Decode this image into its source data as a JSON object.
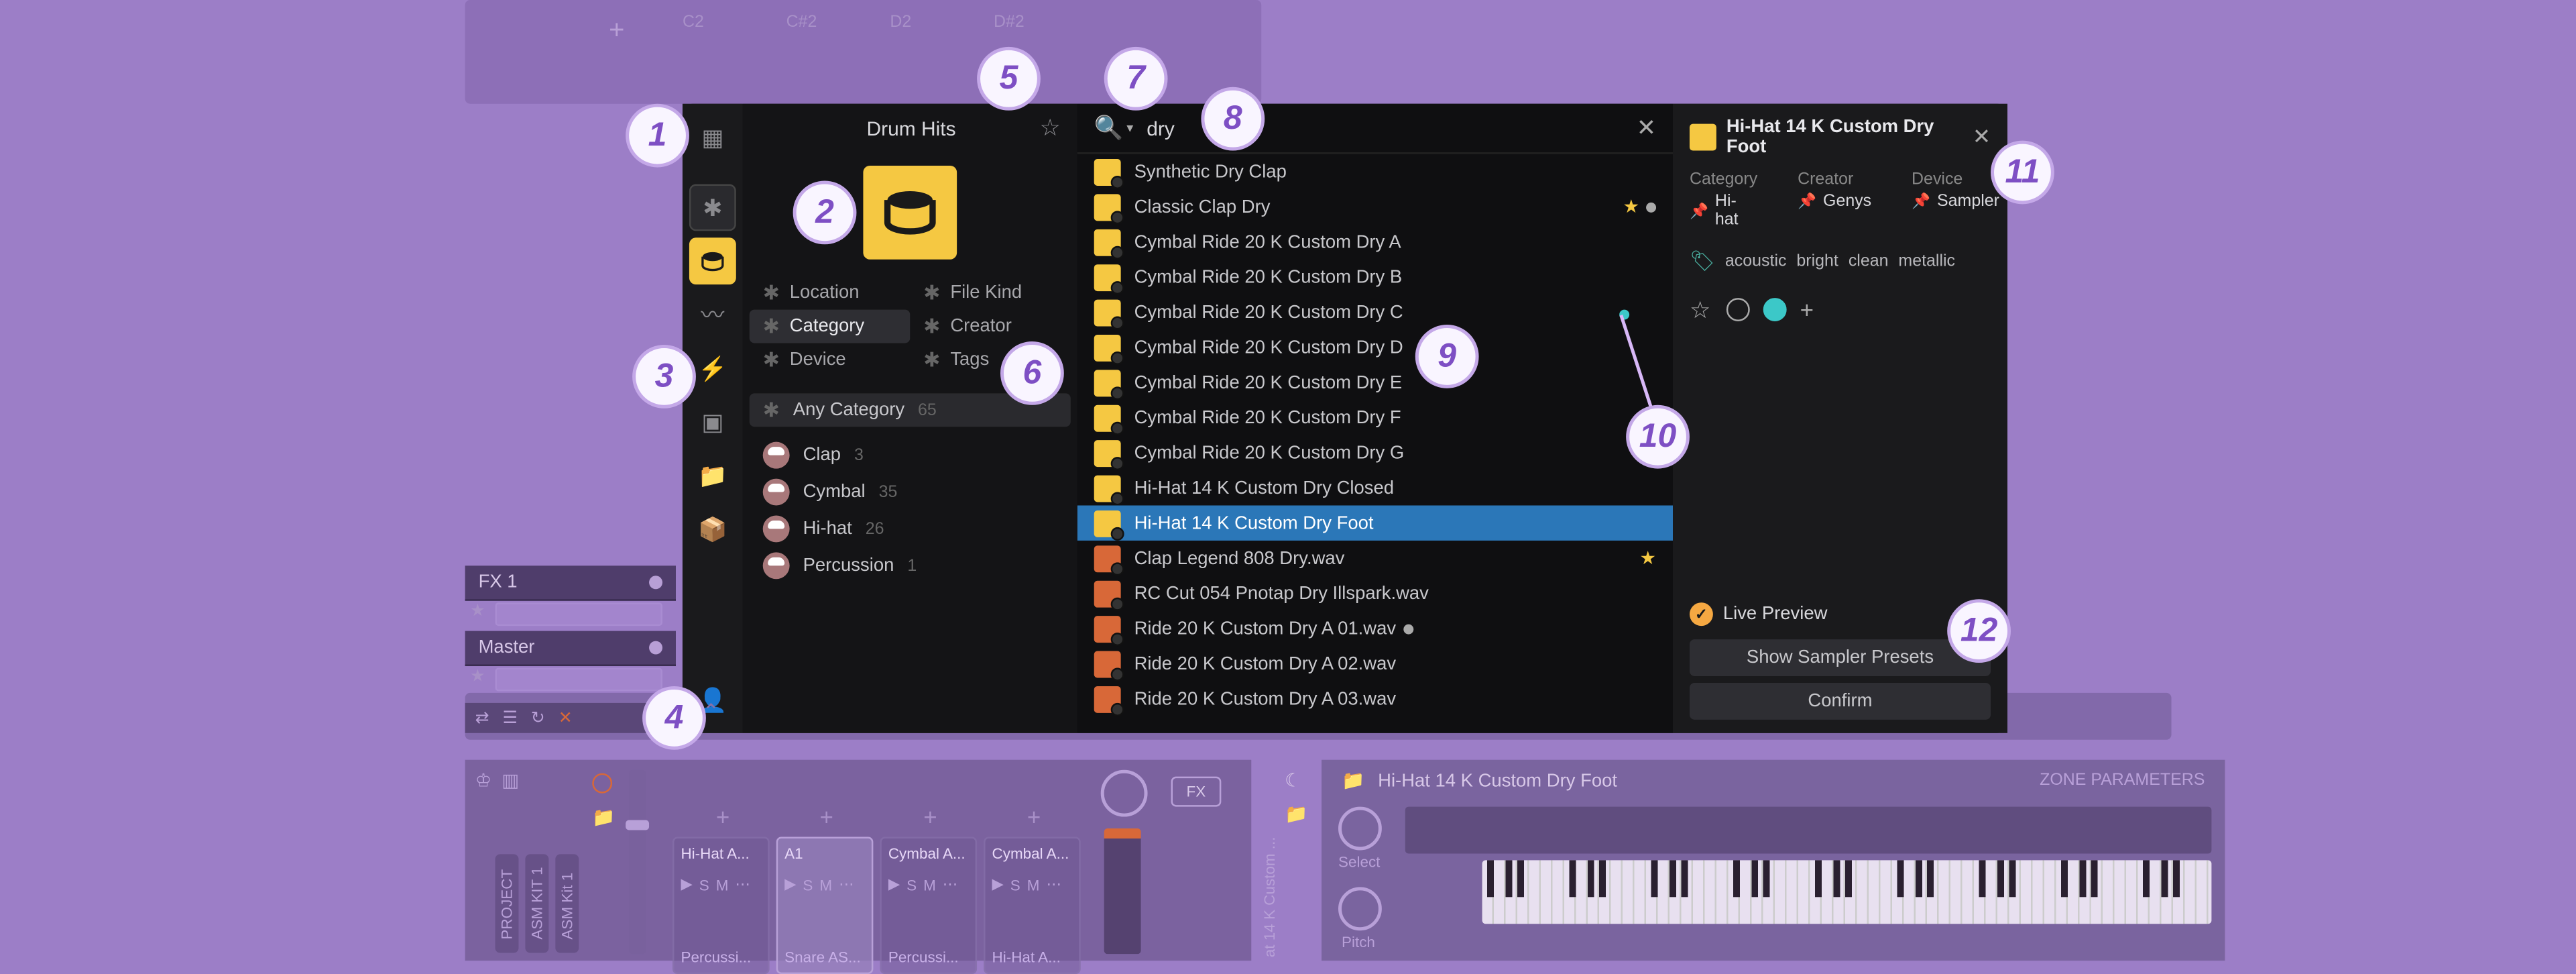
{
  "tab_plus": "+",
  "browser": {
    "title": "Drum Hits",
    "filters": {
      "left": [
        "Location",
        "Category",
        "Device"
      ],
      "right": [
        "File Kind",
        "Creator",
        "Tags"
      ],
      "active": "Category"
    },
    "categories": {
      "header": {
        "label": "Any Category",
        "count": "65"
      },
      "items": [
        {
          "label": "Clap",
          "count": "3"
        },
        {
          "label": "Cymbal",
          "count": "35"
        },
        {
          "label": "Hi-hat",
          "count": "26"
        },
        {
          "label": "Percussion",
          "count": "1"
        }
      ]
    },
    "search": {
      "value": "dry"
    },
    "results": [
      {
        "label": "Synthetic Dry Clap",
        "icon": "sample"
      },
      {
        "label": "Classic Clap Dry",
        "icon": "sample",
        "star": true,
        "dot": true
      },
      {
        "label": "Cymbal Ride 20 K Custom Dry A",
        "icon": "sample"
      },
      {
        "label": "Cymbal Ride 20 K Custom Dry B",
        "icon": "sample"
      },
      {
        "label": "Cymbal Ride 20 K Custom Dry C",
        "icon": "sample"
      },
      {
        "label": "Cymbal Ride 20 K Custom Dry D",
        "icon": "sample"
      },
      {
        "label": "Cymbal Ride 20 K Custom Dry E",
        "icon": "sample"
      },
      {
        "label": "Cymbal Ride 20 K Custom Dry F",
        "icon": "sample"
      },
      {
        "label": "Cymbal Ride 20 K Custom Dry G",
        "icon": "sample"
      },
      {
        "label": "Hi-Hat 14 K Custom Dry Closed",
        "icon": "sample"
      },
      {
        "label": "Hi-Hat 14 K Custom Dry Foot",
        "icon": "sample",
        "selected": true
      },
      {
        "label": "Clap Legend 808 Dry.wav",
        "icon": "wav",
        "star": true
      },
      {
        "label": "RC Cut 054 Pnotap Dry Illspark.wav",
        "icon": "wav"
      },
      {
        "label": "Ride 20 K Custom Dry A 01.wav",
        "icon": "wav",
        "dot": true
      },
      {
        "label": "Ride 20 K Custom Dry A 02.wav",
        "icon": "wav"
      },
      {
        "label": "Ride 20 K Custom Dry A 03.wav",
        "icon": "wav"
      }
    ],
    "detail": {
      "title": "Hi-Hat 14 K Custom Dry Foot",
      "meta": [
        {
          "label": "Category",
          "value": "Hi-hat"
        },
        {
          "label": "Creator",
          "value": "Genys"
        },
        {
          "label": "Device",
          "value": "Sampler"
        }
      ],
      "tags": [
        "acoustic",
        "bright",
        "clean",
        "metallic"
      ],
      "live_preview": "Live Preview",
      "buttons": {
        "show_presets": "Show Sampler Presets",
        "confirm": "Confirm"
      }
    }
  },
  "tracks": {
    "fx": "FX 1",
    "master": "Master"
  },
  "pads": {
    "labels": [
      "C2",
      "C#2",
      "D2",
      "D#2"
    ],
    "cells": [
      {
        "name": "Hi-Hat A...",
        "note": "",
        "bottom": "Percussi..."
      },
      {
        "name": "A1",
        "note": "",
        "bottom": "Snare AS...",
        "active": true
      },
      {
        "name": "Cymbal A...",
        "note": "",
        "bottom": "Percussi..."
      },
      {
        "name": "Cymbal A...",
        "note": "",
        "bottom": "Hi-Hat A..."
      }
    ],
    "fx_label": "FX"
  },
  "side_labels": [
    "PROJECT",
    "ASM KIT 1",
    "ASM Kit 1"
  ],
  "sampler": {
    "name": "Hi-Hat 14 K Custom Dry Foot",
    "zone_label": "ZONE PARAMETERS",
    "knobs": {
      "select": "Select",
      "pitch": "Pitch"
    },
    "vlabel": "at 14 K Custom ..."
  },
  "callouts": [
    "1",
    "2",
    "3",
    "4",
    "5",
    "6",
    "7",
    "8",
    "9",
    "10",
    "11",
    "12"
  ]
}
